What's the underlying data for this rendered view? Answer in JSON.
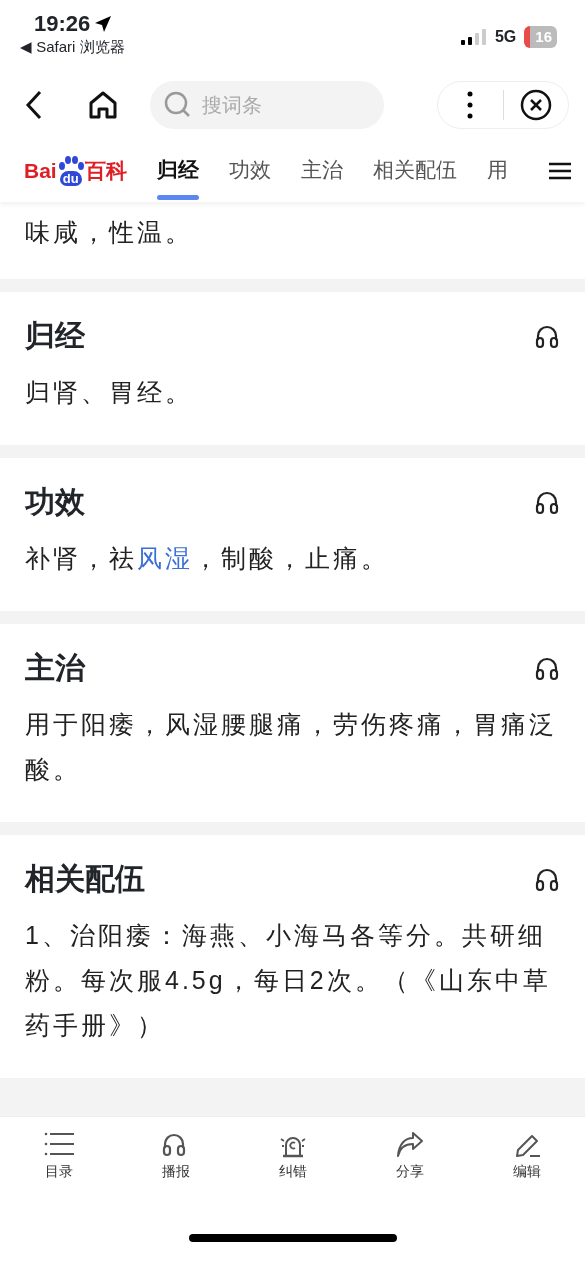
{
  "status_bar": {
    "time": "19:26",
    "back_app": "◀ Safari 浏览器",
    "network": "5G",
    "battery": "16"
  },
  "browser_bar": {
    "search": {
      "placeholder": "搜词条"
    }
  },
  "logo": {
    "left": "Bai",
    "paw": "du",
    "right": "百科"
  },
  "tabs": [
    {
      "label": "归经",
      "selected": true
    },
    {
      "label": "功效",
      "selected": false
    },
    {
      "label": "主治",
      "selected": false
    },
    {
      "label": "相关配伍",
      "selected": false
    },
    {
      "label": "用",
      "selected": false
    }
  ],
  "sections": [
    {
      "body": [
        {
          "kind": "text",
          "text": "味咸，性温。"
        }
      ]
    },
    {
      "title": "归经",
      "body": [
        {
          "kind": "text",
          "text": "归肾、胃经。"
        }
      ]
    },
    {
      "title": "功效",
      "body": [
        {
          "kind": "text",
          "text": "补肾，祛"
        },
        {
          "kind": "link",
          "text": "风湿"
        },
        {
          "kind": "text",
          "text": "，制酸，止痛。"
        }
      ]
    },
    {
      "title": "主治",
      "body": [
        {
          "kind": "text",
          "text": "用于阳痿，风湿腰腿痛，劳伤疼痛，胃痛泛酸。"
        }
      ]
    },
    {
      "title": "相关配伍",
      "body": [
        {
          "kind": "text",
          "text": "1、治阳痿：海燕、小海马各等分。共研细粉。每次服4.5g，每日2次。（《山东中草药手册》）"
        }
      ]
    }
  ],
  "bottom_bar": [
    {
      "kind": "contents",
      "label": "目录"
    },
    {
      "kind": "listen",
      "label": "播报"
    },
    {
      "kind": "report",
      "label": "纠错"
    },
    {
      "kind": "share",
      "label": "分享"
    },
    {
      "kind": "edit",
      "label": "编辑"
    }
  ]
}
